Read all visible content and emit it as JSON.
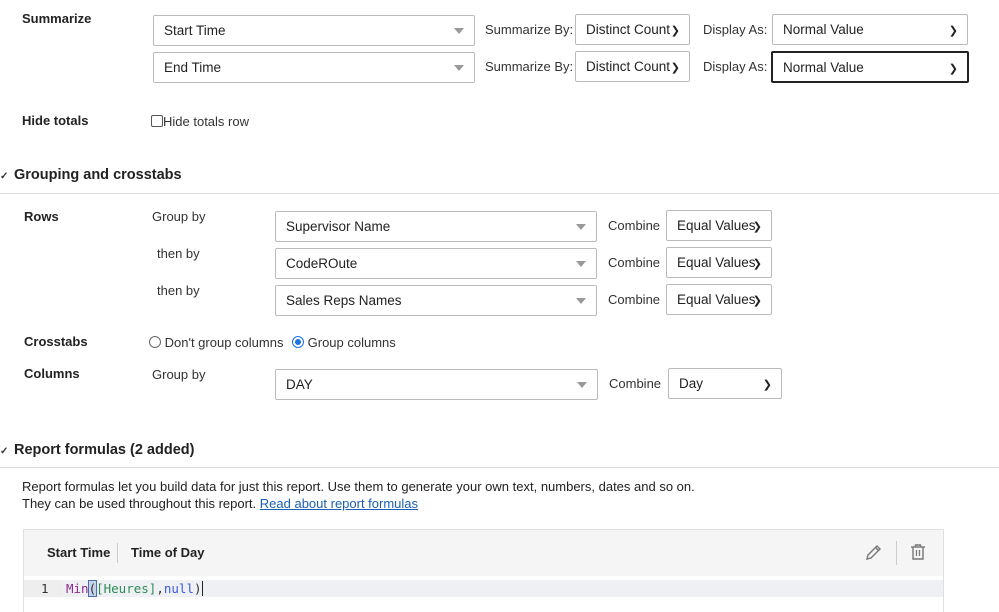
{
  "summarize": {
    "label": "Summarize",
    "rows": [
      {
        "field": "Start Time",
        "summarize_by_label": "Summarize By:",
        "summarize_by": "Distinct Count",
        "display_as_label": "Display As:",
        "display_as": "Normal Value"
      },
      {
        "field": "End Time",
        "summarize_by_label": "Summarize By:",
        "summarize_by": "Distinct Count",
        "display_as_label": "Display As:",
        "display_as": "Normal Value"
      }
    ]
  },
  "hide_totals": {
    "label": "Hide totals",
    "checkbox_label": "Hide totals row",
    "checked": false
  },
  "grouping": {
    "title": "Grouping and crosstabs",
    "rows_label": "Rows",
    "rows": [
      {
        "prefix": "Group by",
        "field": "Supervisor Name",
        "combine_label": "Combine",
        "combine": "Equal Values"
      },
      {
        "prefix": "then by",
        "field": "CodeROute",
        "combine_label": "Combine",
        "combine": "Equal Values"
      },
      {
        "prefix": "then by",
        "field": "Sales Reps Names",
        "combine_label": "Combine",
        "combine": "Equal Values"
      }
    ],
    "crosstabs_label": "Crosstabs",
    "crosstab_options": [
      "Don't group columns",
      "Group columns"
    ],
    "crosstab_selected": "Group columns",
    "columns_label": "Columns",
    "columns": {
      "prefix": "Group by",
      "field": "DAY",
      "combine_label": "Combine",
      "combine": "Day"
    }
  },
  "report_formulas": {
    "title": "Report formulas (2 added)",
    "description_line1": "Report formulas let you build data for just this report. Use them to generate your own text, numbers, dates and so on.",
    "description_line2": "They can be used throughout this report.",
    "link": "Read about report formulas",
    "formula": {
      "name": "Start Time",
      "type": "Time of Day",
      "editor": {
        "line_number": "1",
        "tokens": {
          "fn": "Min",
          "open": "(",
          "field": "[Heures]",
          "comma": ",",
          "null": "null",
          "close": ")"
        }
      }
    }
  }
}
